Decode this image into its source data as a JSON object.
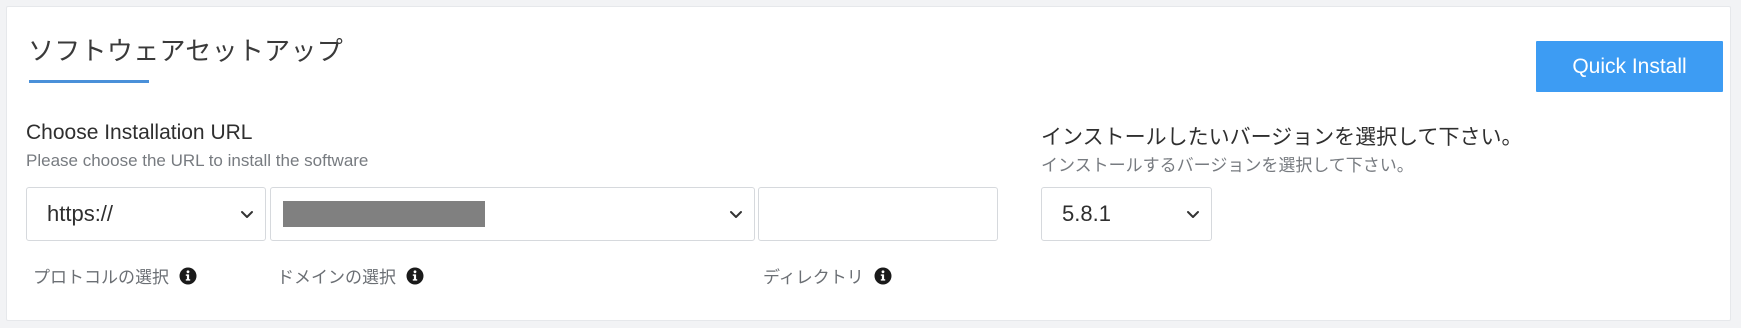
{
  "page": {
    "title": "ソフトウェアセットアップ",
    "quick_install_label": "Quick Install"
  },
  "installation_url": {
    "heading": "Choose Installation URL",
    "subheading": "Please choose the URL to install the software",
    "protocol": {
      "selected": "https://",
      "label": "プロトコルの選択"
    },
    "domain": {
      "selected": "",
      "label": "ドメインの選択"
    },
    "directory": {
      "value": "",
      "placeholder": "",
      "label": "ディレクトリ"
    }
  },
  "version": {
    "heading": "インストールしたいバージョンを選択して下さい。",
    "subheading": "インストールするバージョンを選択して下さい。",
    "selected": "5.8.1"
  },
  "colors": {
    "accent": "#3d9cf3",
    "underline": "#4a90d9",
    "masked": "#808080"
  },
  "icons": {
    "dropdown": "chevron-down-icon",
    "help": "info-icon"
  }
}
